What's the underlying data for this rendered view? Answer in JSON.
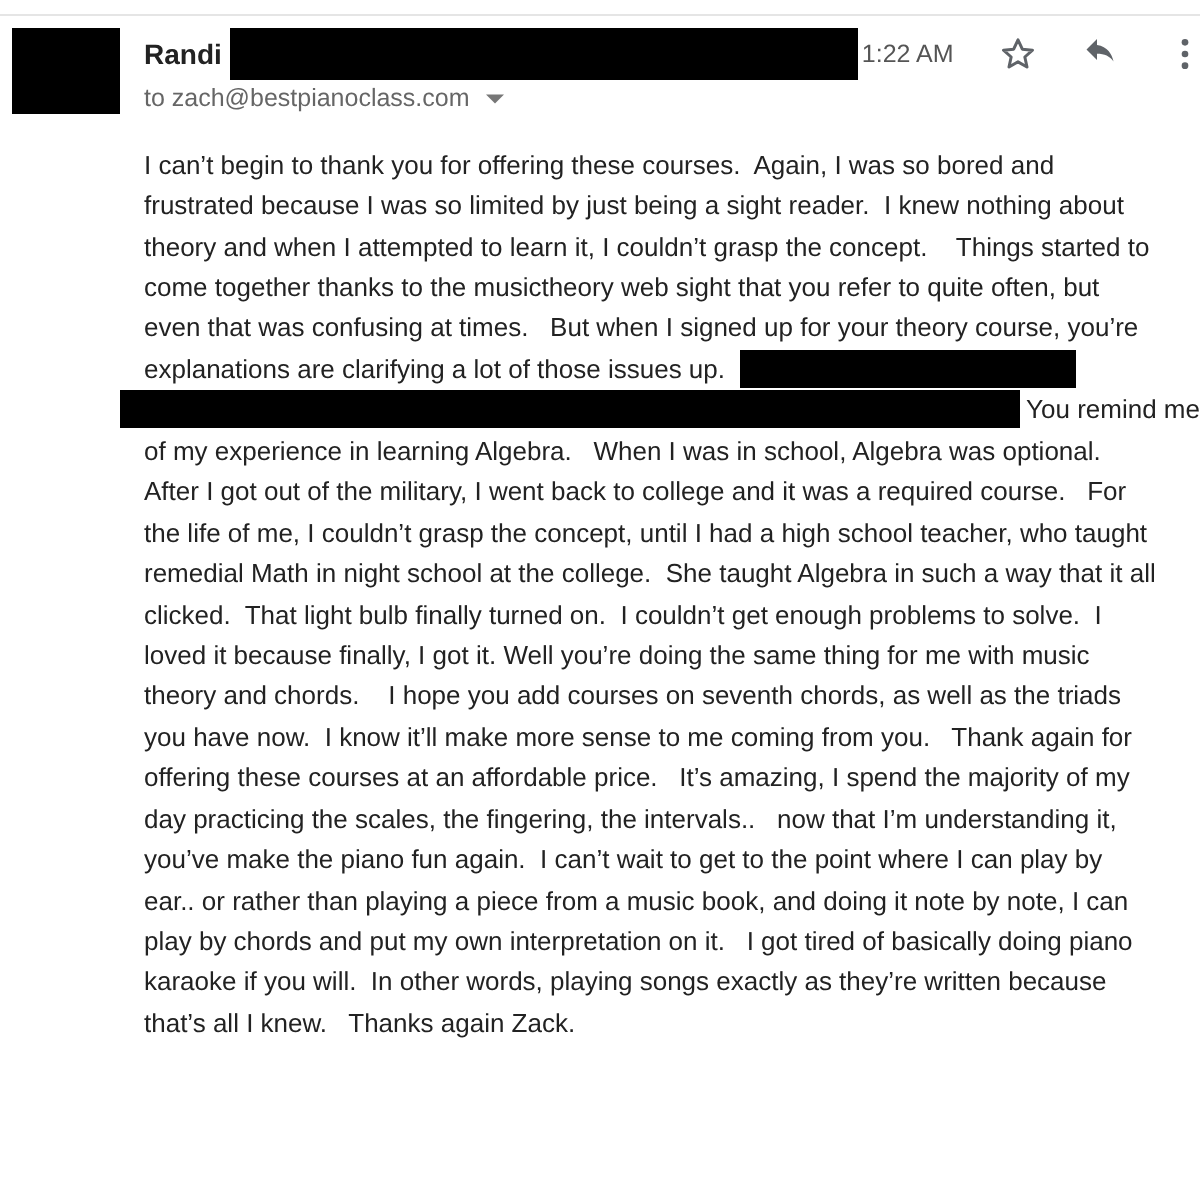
{
  "message": {
    "sender": "Randi",
    "sender_detail_redacted": true,
    "avatar_redacted": true,
    "time": "1:22 AM",
    "recipient": "to zach@bestpianoclass.com",
    "body_lines": [
      [
        {
          "kind": "text",
          "text": "I can’t begin to thank you for offering these courses.  Again, I was so bored and"
        }
      ],
      [
        {
          "kind": "text",
          "text": "frustrated because I was so limited by just being a sight reader.  I knew nothing about"
        }
      ],
      [
        {
          "kind": "text",
          "text": "theory and when I attempted to learn it, I couldn’t grasp the concept.    Things started to"
        }
      ],
      [
        {
          "kind": "text",
          "text": "come together thanks to the musictheory web sight that you refer to quite often, but"
        }
      ],
      [
        {
          "kind": "text",
          "text": "even that was confusing at times.   But when I signed up for your theory course, you’re"
        }
      ],
      [
        {
          "kind": "text",
          "text": "explanations are clarifying a lot of those issues up.  "
        },
        {
          "kind": "redacted"
        }
      ],
      [
        {
          "kind": "redacted"
        },
        {
          "kind": "text",
          "text": " You remind me"
        }
      ],
      [
        {
          "kind": "text",
          "text": "of my experience in learning Algebra.   When I was in school, Algebra was optional."
        }
      ],
      [
        {
          "kind": "text",
          "text": "After I got out of the military, I went back to college and it was a required course.   For"
        }
      ],
      [
        {
          "kind": "text",
          "text": "the life of me, I couldn’t grasp the concept, until I had a high school teacher, who taught"
        }
      ],
      [
        {
          "kind": "text",
          "text": "remedial Math in night school at the college.  She taught Algebra in such a way that it all"
        }
      ],
      [
        {
          "kind": "text",
          "text": "clicked.  That light bulb finally turned on.  I couldn’t get enough problems to solve.  I"
        }
      ],
      [
        {
          "kind": "text",
          "text": "loved it because finally, I got it. Well you’re doing the same thing for me with music"
        }
      ],
      [
        {
          "kind": "text",
          "text": "theory and chords.    I hope you add courses on seventh chords, as well as the triads"
        }
      ],
      [
        {
          "kind": "text",
          "text": "you have now.  I know it’ll make more sense to me coming from you.   Thank again for"
        }
      ],
      [
        {
          "kind": "text",
          "text": "offering these courses at an affordable price.   It’s amazing, I spend the majority of my"
        }
      ],
      [
        {
          "kind": "text",
          "text": "day practicing the scales, the fingering, the intervals..   now that I’m understanding it,"
        }
      ],
      [
        {
          "kind": "text",
          "text": "you’ve make the piano fun again.  I can’t wait to get to the point where I can play by"
        }
      ],
      [
        {
          "kind": "text",
          "text": "ear.. or rather than playing a piece from a music book, and doing it note by note, I can"
        }
      ],
      [
        {
          "kind": "text",
          "text": "play by chords and put my own interpretation on it.   I got tired of basically doing piano"
        }
      ],
      [
        {
          "kind": "text",
          "text": "karaoke if you will.  In other words, playing songs exactly as they’re written because"
        }
      ],
      [
        {
          "kind": "text",
          "text": "that’s all I knew.   Thanks again Zack."
        }
      ]
    ]
  }
}
